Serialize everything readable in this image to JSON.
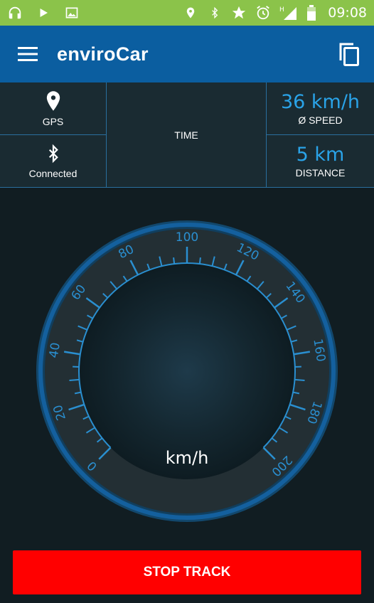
{
  "statusbar": {
    "time": "09:08",
    "left_icons": [
      "headphones-icon",
      "play-icon",
      "image-icon"
    ],
    "right_icons": [
      "location-icon",
      "bluetooth-icon",
      "star-icon",
      "alarm-icon",
      "signal-icon",
      "battery-icon"
    ],
    "network_label": "H"
  },
  "appbar": {
    "title": "enviroCar",
    "background": "#0b5ea0"
  },
  "info": {
    "gps_label": "GPS",
    "bluetooth_label": "Connected",
    "time_label": "TIME",
    "speed_value": "36 km/h",
    "speed_label": "Ø SPEED",
    "distance_value": "5 km",
    "distance_label": "DISTANCE",
    "accent": "#2aa3e8"
  },
  "gauge": {
    "unit": "km/h",
    "min": 0,
    "max": 200,
    "current_speed": 0,
    "tick_labels": [
      "0",
      "20",
      "40",
      "60",
      "80",
      "100",
      "120",
      "140",
      "160",
      "180",
      "200"
    ]
  },
  "actions": {
    "stop_label": "STOP TRACK",
    "stop_color": "#ff0000"
  }
}
